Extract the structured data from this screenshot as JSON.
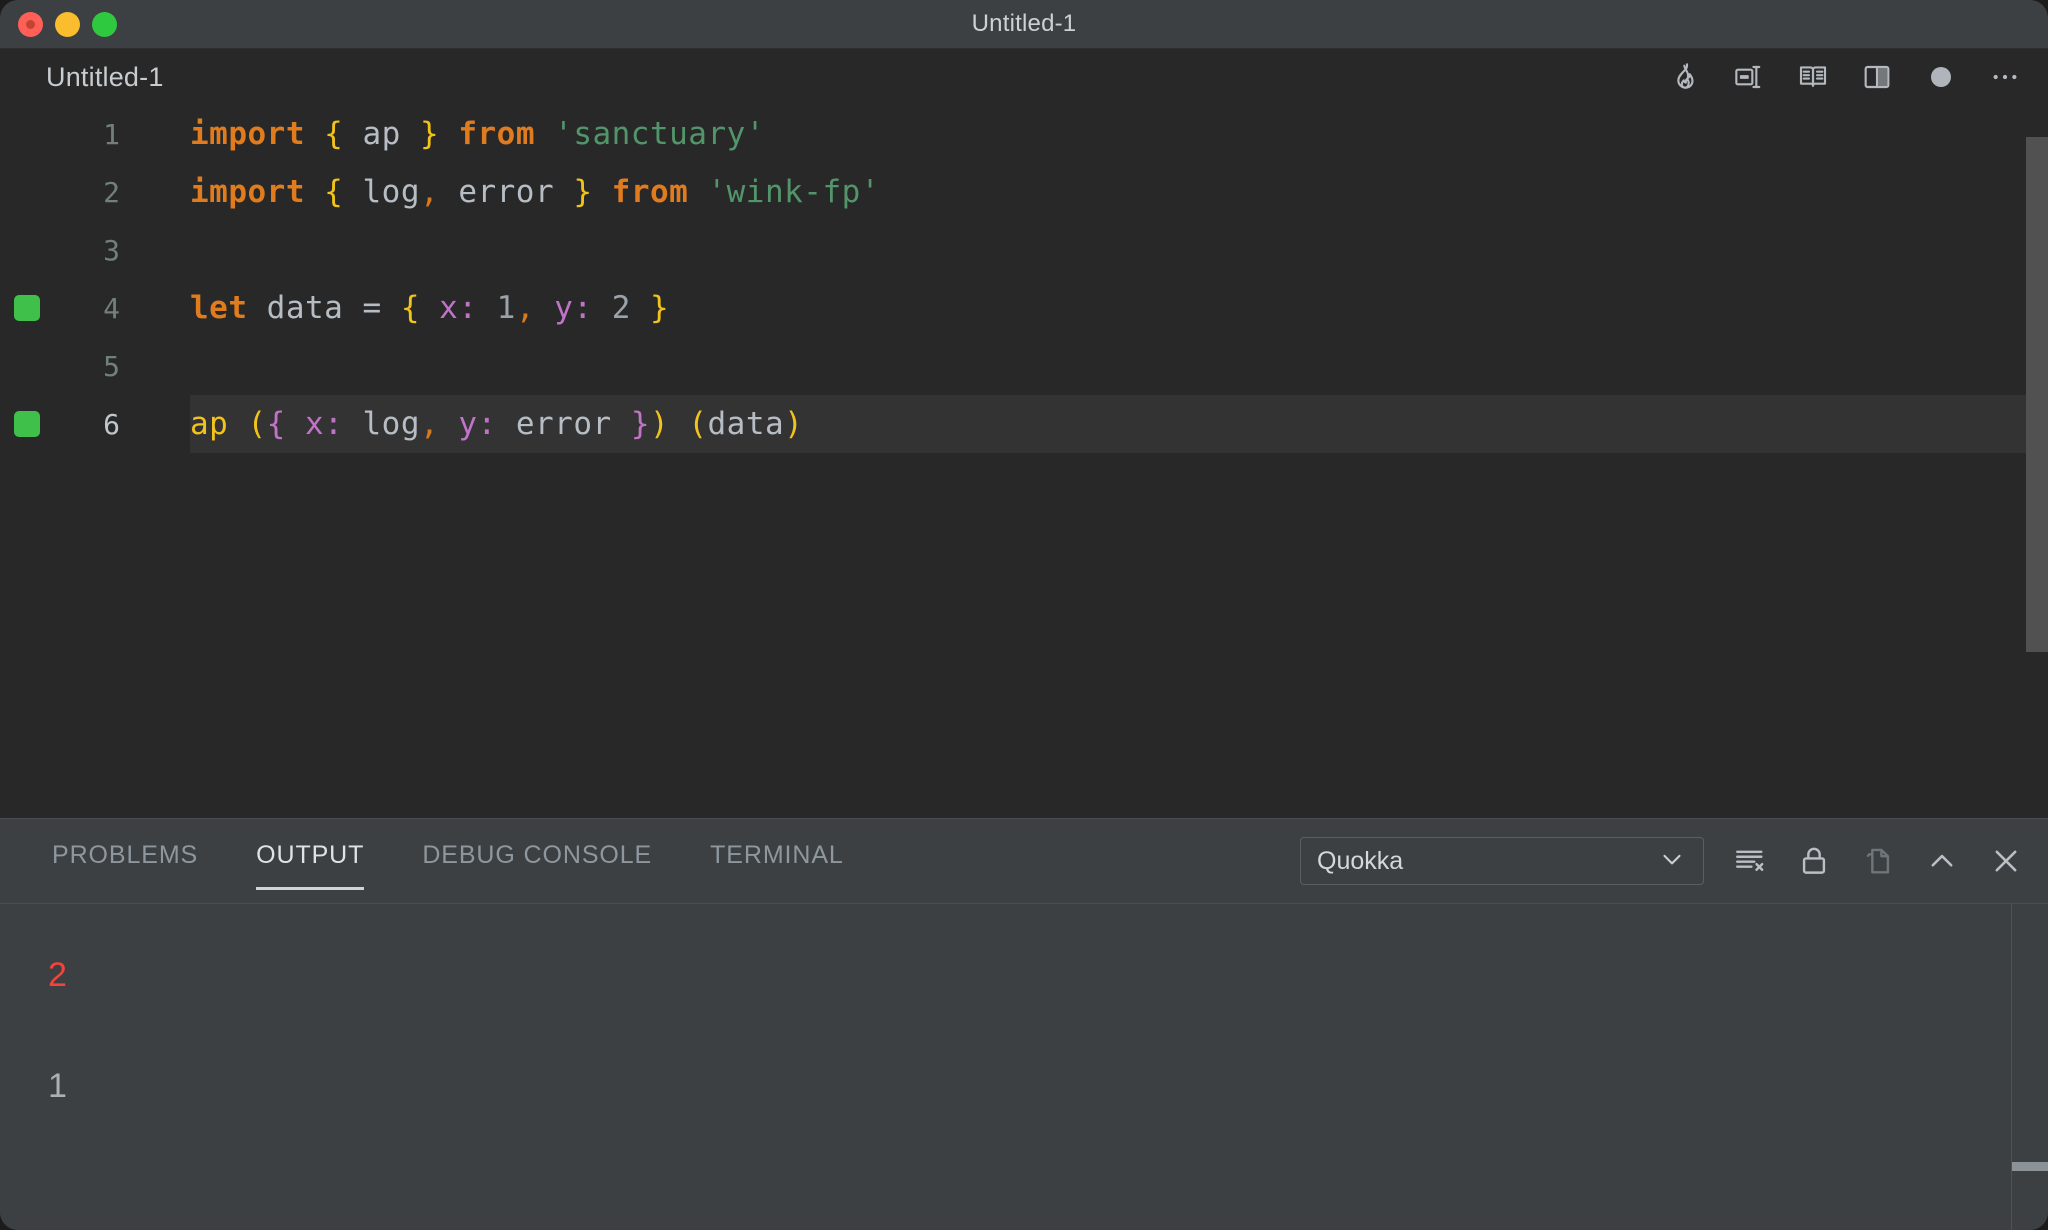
{
  "window": {
    "title": "Untitled-1",
    "traffic_lights": [
      "close",
      "minimize",
      "maximize"
    ]
  },
  "editor": {
    "breadcrumb": "Untitled-1",
    "actions": [
      {
        "name": "quokka-flame-icon",
        "label": "Quokka"
      },
      {
        "name": "split-editor-right-icon",
        "label": "Split Editor Right"
      },
      {
        "name": "open-preview-icon",
        "label": "Open Preview"
      },
      {
        "name": "toggle-layout-icon",
        "label": "Toggle Layout"
      },
      {
        "name": "unsaved-dot-icon",
        "label": "Unsaved changes"
      },
      {
        "name": "more-actions-icon",
        "label": "More Actions..."
      }
    ],
    "lines": [
      {
        "number": "1",
        "marker": false,
        "active": false
      },
      {
        "number": "2",
        "marker": false,
        "active": false
      },
      {
        "number": "3",
        "marker": false,
        "active": false
      },
      {
        "number": "4",
        "marker": true,
        "active": false
      },
      {
        "number": "5",
        "marker": false,
        "active": false
      },
      {
        "number": "6",
        "marker": true,
        "active": true
      }
    ],
    "code": {
      "line1": {
        "t1": "import",
        "t2": " ",
        "t3": "{",
        "t4": " ap ",
        "t5": "}",
        "t6": " ",
        "t7": "from",
        "t8": " ",
        "t9": "'sanctuary'"
      },
      "line2": {
        "t1": "import",
        "t2": " ",
        "t3": "{",
        "t4": " log",
        "t5": ",",
        "t6": " error ",
        "t7": "}",
        "t8": " ",
        "t9": "from",
        "t10": " ",
        "t11": "'wink-fp'"
      },
      "line3": {
        "t1": ""
      },
      "line4": {
        "t1": "let",
        "t2": " data ",
        "t3": "=",
        "t4": " ",
        "t5": "{",
        "t6": " ",
        "t7": "x:",
        "t8": " ",
        "t9": "1",
        "t10": ",",
        "t11": " ",
        "t12": "y:",
        "t13": " ",
        "t14": "2",
        "t15": " ",
        "t16": "}"
      },
      "line5": {
        "t1": ""
      },
      "line6": {
        "t1": "ap",
        "t2": " ",
        "t3": "(",
        "t4": "{",
        "t5": " ",
        "t6": "x:",
        "t7": " log",
        "t8": ",",
        "t9": " ",
        "t10": "y:",
        "t11": " error ",
        "t12": "}",
        "t13": ")",
        "t14": " ",
        "t15": "(",
        "t16": "data",
        "t17": ")"
      }
    },
    "colors": {
      "background": "#282828",
      "active_line": "#333333",
      "keyword": "#e07c1e",
      "string": "#53956a",
      "brace_yellow": "#f2c31b",
      "brace_purple": "#c173c7",
      "plain": "#b6bdc4",
      "marker_green": "#3fc04a"
    }
  },
  "panel": {
    "tabs": [
      {
        "label": "PROBLEMS",
        "active": false
      },
      {
        "label": "OUTPUT",
        "active": true
      },
      {
        "label": "DEBUG CONSOLE",
        "active": false
      },
      {
        "label": "TERMINAL",
        "active": false
      }
    ],
    "channel_select": {
      "value": "Quokka",
      "options": [
        "Quokka"
      ]
    },
    "controls": [
      {
        "name": "clear-output-icon",
        "label": "Clear Output"
      },
      {
        "name": "lock-scroll-icon",
        "label": "Turn Auto Scrolling Off"
      },
      {
        "name": "open-in-editor-icon",
        "label": "Open Output in Editor"
      },
      {
        "name": "maximize-panel-icon",
        "label": "Maximize Panel Size"
      },
      {
        "name": "close-panel-icon",
        "label": "Close Panel"
      }
    ],
    "output_lines": [
      {
        "text": "2",
        "type": "error"
      },
      {
        "text": "1",
        "type": "normal"
      }
    ],
    "colors": {
      "background": "#3c4043",
      "error": "#f4433c",
      "normal": "#aab0b6"
    }
  }
}
